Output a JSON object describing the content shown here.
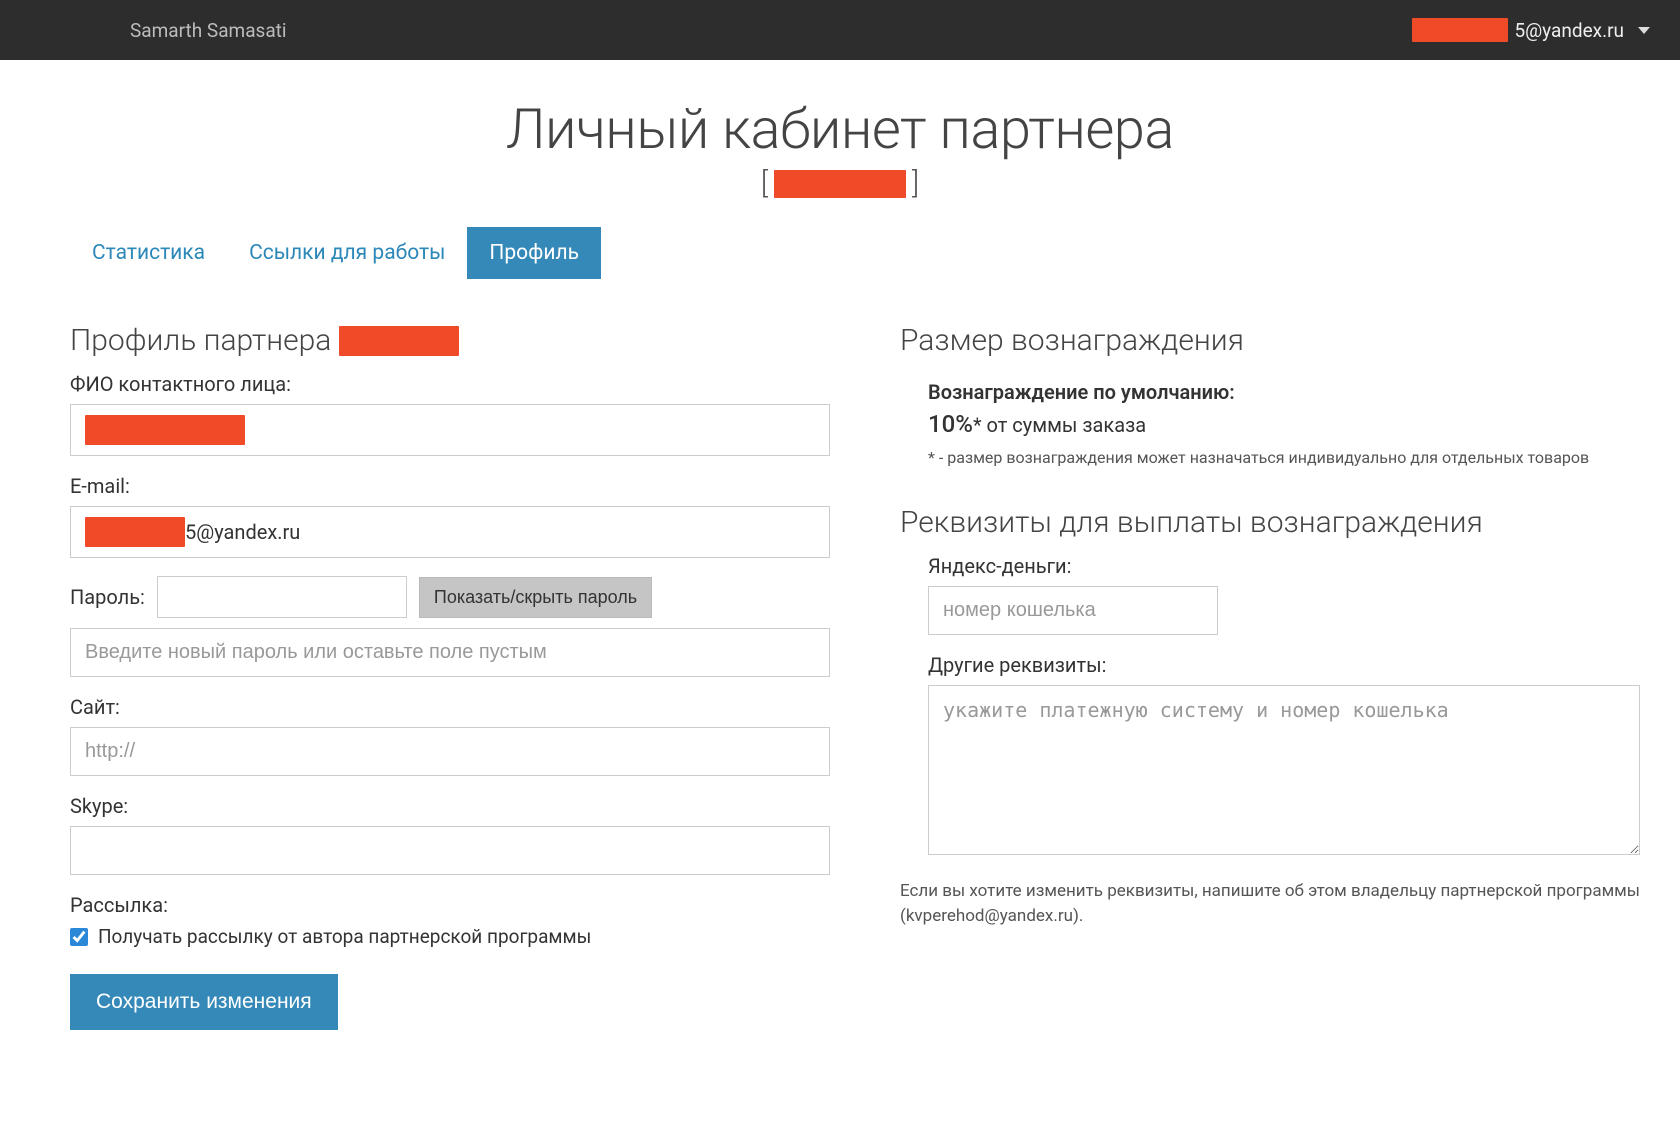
{
  "topbar": {
    "brand": "Samarth Samasati",
    "user_suffix": "5@yandex.ru"
  },
  "page": {
    "title": "Личный кабинет партнера",
    "sub_open": "[",
    "sub_close": "]"
  },
  "tabs": {
    "stats": "Статистика",
    "links": "Ссылки для работы",
    "profile": "Профиль"
  },
  "profile": {
    "heading_prefix": "Профиль партнера ",
    "fio_label": "ФИО контактного лица:",
    "email_label": "E-mail:",
    "email_suffix": "5@yandex.ru",
    "password_label": "Пароль:",
    "toggle_password": "Показать/скрыть пароль",
    "new_password_placeholder": "Введите новый пароль или оставьте поле пустым",
    "site_label": "Сайт:",
    "site_placeholder": "http://",
    "skype_label": "Skype:",
    "mailing_label": "Рассылка:",
    "mailing_checkbox": "Получать рассылку от автора партнерской программы",
    "save_button": "Сохранить изменения"
  },
  "reward": {
    "heading": "Размер вознаграждения",
    "default_label": "Вознаграждение по умолчанию:",
    "percent": "10%",
    "percent_suffix": "* от суммы заказа",
    "note": "* - размер вознаграждения может назначаться индивидуально для отдельных товаров"
  },
  "requisites": {
    "heading": "Реквизиты для выплаты вознаграждения",
    "yandex_label": "Яндекс-деньги:",
    "yandex_placeholder": "номер кошелька",
    "other_label": "Другие реквизиты:",
    "other_placeholder": "укажите платежную систему и номер кошелька",
    "change_note": "Если вы хотите изменить реквизиты, напишите об этом владельцу партнерской программы (kvperehod@yandex.ru)."
  }
}
